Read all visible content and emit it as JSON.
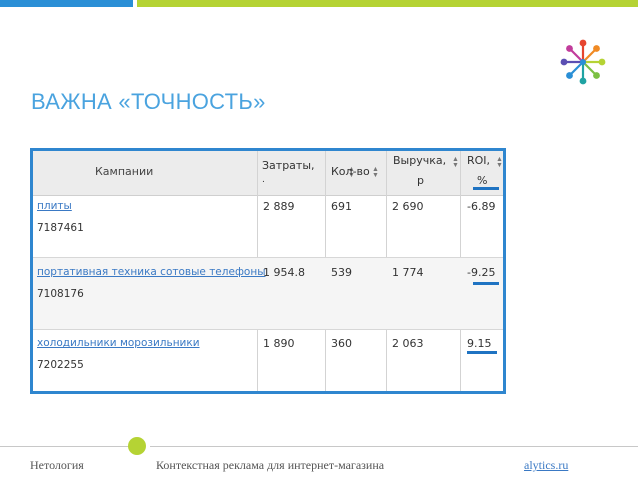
{
  "slide": {
    "title": "ВАЖНА «ТОЧНОСТЬ»",
    "accent_blue": "#2a8fd6",
    "accent_green": "#b5d334"
  },
  "table": {
    "headers": {
      "campaign": "Кампании",
      "cost": "Затраты,",
      "cost_dot": ".",
      "qty": "Кол-во",
      "revenue": "Выручка,",
      "revenue_unit": "р",
      "roi": "ROI,",
      "roi_unit": "%"
    },
    "rows": [
      {
        "name": "плиты",
        "id": "7187461",
        "cost": "2 889",
        "qty": "691",
        "revenue": "2 690",
        "roi": "-6.89"
      },
      {
        "name": "портативная техника сотовые телефоны",
        "id": "7108176",
        "cost": "1 954.8",
        "qty": "539",
        "revenue": "1 774",
        "roi": "-9.25"
      },
      {
        "name": "холодильники морозильники",
        "id": "7202255",
        "cost": "1 890",
        "qty": "360",
        "revenue": "2 063",
        "roi": "9.15"
      }
    ]
  },
  "footer": {
    "left": "Нетология",
    "center": "Контекстная реклама для интернет-магазина",
    "right": "alytics.ru"
  }
}
